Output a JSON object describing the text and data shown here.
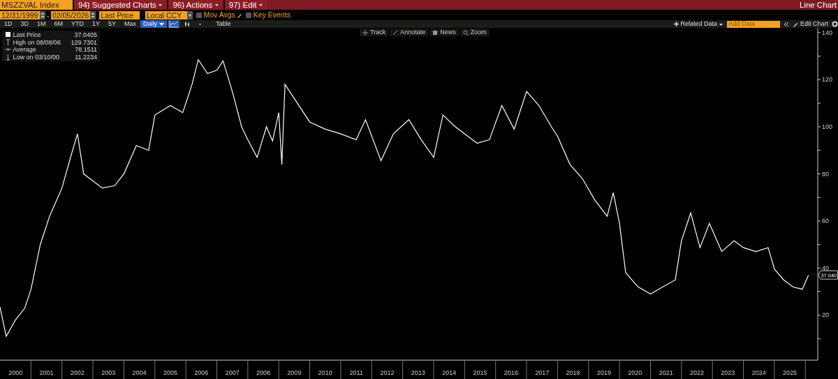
{
  "header": {
    "security": "MSZZVAL Index",
    "menus": [
      {
        "number": "94)",
        "label": "Suggested Charts"
      },
      {
        "number": "96)",
        "label": "Actions"
      },
      {
        "number": "97)",
        "label": "Edit"
      }
    ],
    "title": "Line Chart"
  },
  "settings": {
    "start_date": "12/31/1999",
    "date_separator": "-",
    "end_date": "02/05/2026",
    "field": "Last Price",
    "currency": "Local CCY",
    "options": [
      {
        "label": "Mov Avgs",
        "checked": false
      },
      {
        "label": "Key Events",
        "checked": false
      }
    ]
  },
  "periods": [
    {
      "label": "1D",
      "selected": false
    },
    {
      "label": "3D",
      "selected": false
    },
    {
      "label": "1M",
      "selected": false
    },
    {
      "label": "6M",
      "selected": false
    },
    {
      "label": "YTD",
      "selected": false
    },
    {
      "label": "1Y",
      "selected": false
    },
    {
      "label": "5Y",
      "selected": false
    },
    {
      "label": "Max",
      "selected": false
    }
  ],
  "frequency": "Daily",
  "view_buttons": [
    {
      "kind": "line",
      "selected": true
    },
    {
      "kind": "bars",
      "selected": false
    },
    {
      "kind": "more",
      "selected": false
    }
  ],
  "table_label": "Table",
  "right_tools": {
    "related": "Related Data",
    "add_data_placeholder": "Add Data",
    "edit": "Edit Chart"
  },
  "chart_tools": [
    "Track",
    "Annotate",
    "News",
    "Zoom"
  ],
  "legend": [
    {
      "kind": "last",
      "label": "Last Price",
      "value": "37.0405"
    },
    {
      "kind": "high",
      "label": "High on 08/08/06",
      "value": "129.7301"
    },
    {
      "kind": "average",
      "label": "Average",
      "value": "78.1511"
    },
    {
      "kind": "low",
      "label": "Low on 03/10/00",
      "value": "11.2234"
    }
  ],
  "chart_data": {
    "type": "line",
    "xlim": [
      2000,
      2026.4
    ],
    "ylim": [
      0,
      142
    ],
    "xticks": [
      {
        "value": 2000.5,
        "label": "2000"
      },
      {
        "value": 2001.5,
        "label": "2001"
      },
      {
        "value": 2002.5,
        "label": "2002"
      },
      {
        "value": 2003.5,
        "label": "2003"
      },
      {
        "value": 2004.5,
        "label": "2004"
      },
      {
        "value": 2005.5,
        "label": "2005"
      },
      {
        "value": 2006.5,
        "label": "2006"
      },
      {
        "value": 2007.5,
        "label": "2007"
      },
      {
        "value": 2008.5,
        "label": "2008"
      },
      {
        "value": 2009.5,
        "label": "2009"
      },
      {
        "value": 2010.5,
        "label": "2010"
      },
      {
        "value": 2011.5,
        "label": "2011"
      },
      {
        "value": 2012.5,
        "label": "2012"
      },
      {
        "value": 2013.5,
        "label": "2013"
      },
      {
        "value": 2014.5,
        "label": "2014"
      },
      {
        "value": 2015.5,
        "label": "2015"
      },
      {
        "value": 2016.5,
        "label": "2016"
      },
      {
        "value": 2017.5,
        "label": "2017"
      },
      {
        "value": 2018.5,
        "label": "2018"
      },
      {
        "value": 2019.5,
        "label": "2019"
      },
      {
        "value": 2020.5,
        "label": "2020"
      },
      {
        "value": 2021.5,
        "label": "2021"
      },
      {
        "value": 2022.5,
        "label": "2022"
      },
      {
        "value": 2023.5,
        "label": "2023"
      },
      {
        "value": 2024.5,
        "label": "2024"
      },
      {
        "value": 2025.5,
        "label": "2025"
      }
    ],
    "yticks": [
      20,
      40,
      60,
      80,
      100,
      120,
      140
    ],
    "x": [
      2000.0,
      2000.2,
      2000.5,
      2000.8,
      2001.0,
      2001.3,
      2001.6,
      2002.0,
      2002.3,
      2002.5,
      2002.7,
      2003.0,
      2003.3,
      2003.7,
      2004.0,
      2004.4,
      2004.8,
      2005.0,
      2005.5,
      2005.9,
      2006.2,
      2006.4,
      2006.7,
      2007.0,
      2007.2,
      2007.5,
      2007.8,
      2008.0,
      2008.3,
      2008.6,
      2008.8,
      2009.0,
      2009.1,
      2009.2,
      2009.5,
      2010.0,
      2010.5,
      2011.0,
      2011.5,
      2011.8,
      2012.3,
      2012.7,
      2013.2,
      2013.6,
      2014.0,
      2014.3,
      2014.7,
      2015.0,
      2015.4,
      2015.8,
      2016.2,
      2016.6,
      2017.0,
      2017.4,
      2017.8,
      2018.0,
      2018.4,
      2018.8,
      2019.2,
      2019.6,
      2019.8,
      2020.0,
      2020.2,
      2020.6,
      2021.0,
      2021.4,
      2021.8,
      2022.0,
      2022.3,
      2022.6,
      2022.9,
      2023.3,
      2023.7,
      2024.0,
      2024.4,
      2024.8,
      2025.0,
      2025.3,
      2025.6,
      2025.9,
      2026.1
    ],
    "series": [
      {
        "color": "#ffffff",
        "values": [
          23.5,
          11,
          18,
          23,
          31,
          50,
          62,
          74,
          88,
          97,
          80,
          77,
          74,
          75,
          80,
          92,
          90,
          105,
          109,
          106,
          118,
          128.5,
          122.6,
          124,
          128,
          115,
          100,
          94.5,
          87,
          100,
          94,
          106,
          84,
          118,
          112,
          102,
          99,
          97,
          94.5,
          103,
          85.6,
          97,
          103,
          94.5,
          87,
          105,
          100,
          97,
          93,
          94.5,
          109,
          99,
          115,
          109,
          100,
          96,
          84,
          78,
          69,
          62,
          72,
          59,
          38,
          32,
          29,
          32,
          35,
          51.6,
          63.4,
          48.7,
          59,
          47,
          51.6,
          48.7,
          47,
          48.7,
          39.6,
          35,
          32,
          31,
          37
        ]
      }
    ],
    "annotations": [
      {
        "x": 2026.1,
        "y": 37.04,
        "text": "37.040"
      }
    ]
  }
}
